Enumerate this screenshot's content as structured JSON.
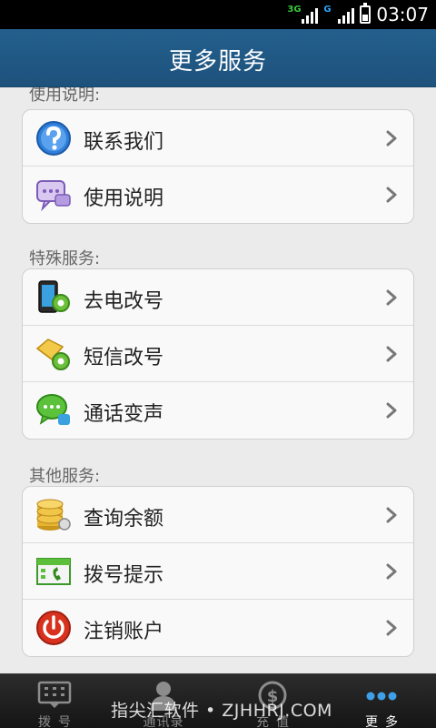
{
  "status_bar": {
    "network_1": "3G",
    "network_2": "G",
    "time": "03:07"
  },
  "header": {
    "title": "更多服务"
  },
  "sections": [
    {
      "title": "使用说明:",
      "items": [
        {
          "label": "联系我们",
          "icon": "help-question-icon"
        },
        {
          "label": "使用说明",
          "icon": "chat-bubbles-icon"
        }
      ]
    },
    {
      "title": "特殊服务:",
      "items": [
        {
          "label": "去电改号",
          "icon": "phone-gear-icon"
        },
        {
          "label": "短信改号",
          "icon": "envelope-gear-icon"
        },
        {
          "label": "通话变声",
          "icon": "voice-chat-icon"
        }
      ]
    },
    {
      "title": "其他服务:",
      "items": [
        {
          "label": "查询余额",
          "icon": "coins-icon"
        },
        {
          "label": "拨号提示",
          "icon": "dial-calendar-icon"
        },
        {
          "label": "注销账户",
          "icon": "power-icon"
        }
      ]
    }
  ],
  "tabs": [
    {
      "label": "拨号",
      "icon": "dialpad-icon",
      "active": false
    },
    {
      "label": "通讯录",
      "icon": "contacts-icon",
      "active": false
    },
    {
      "label": "充值",
      "icon": "recharge-icon",
      "active": false
    },
    {
      "label": "更多",
      "icon": "more-dots-icon",
      "active": true
    }
  ],
  "watermark": "指尖汇软件 • ZJHHRJ.COM",
  "colors": {
    "header": "#1f5682",
    "background": "#ebebeb",
    "tabbar": "#1e1e1e",
    "active_tab_dots": "#3fa0e8"
  }
}
